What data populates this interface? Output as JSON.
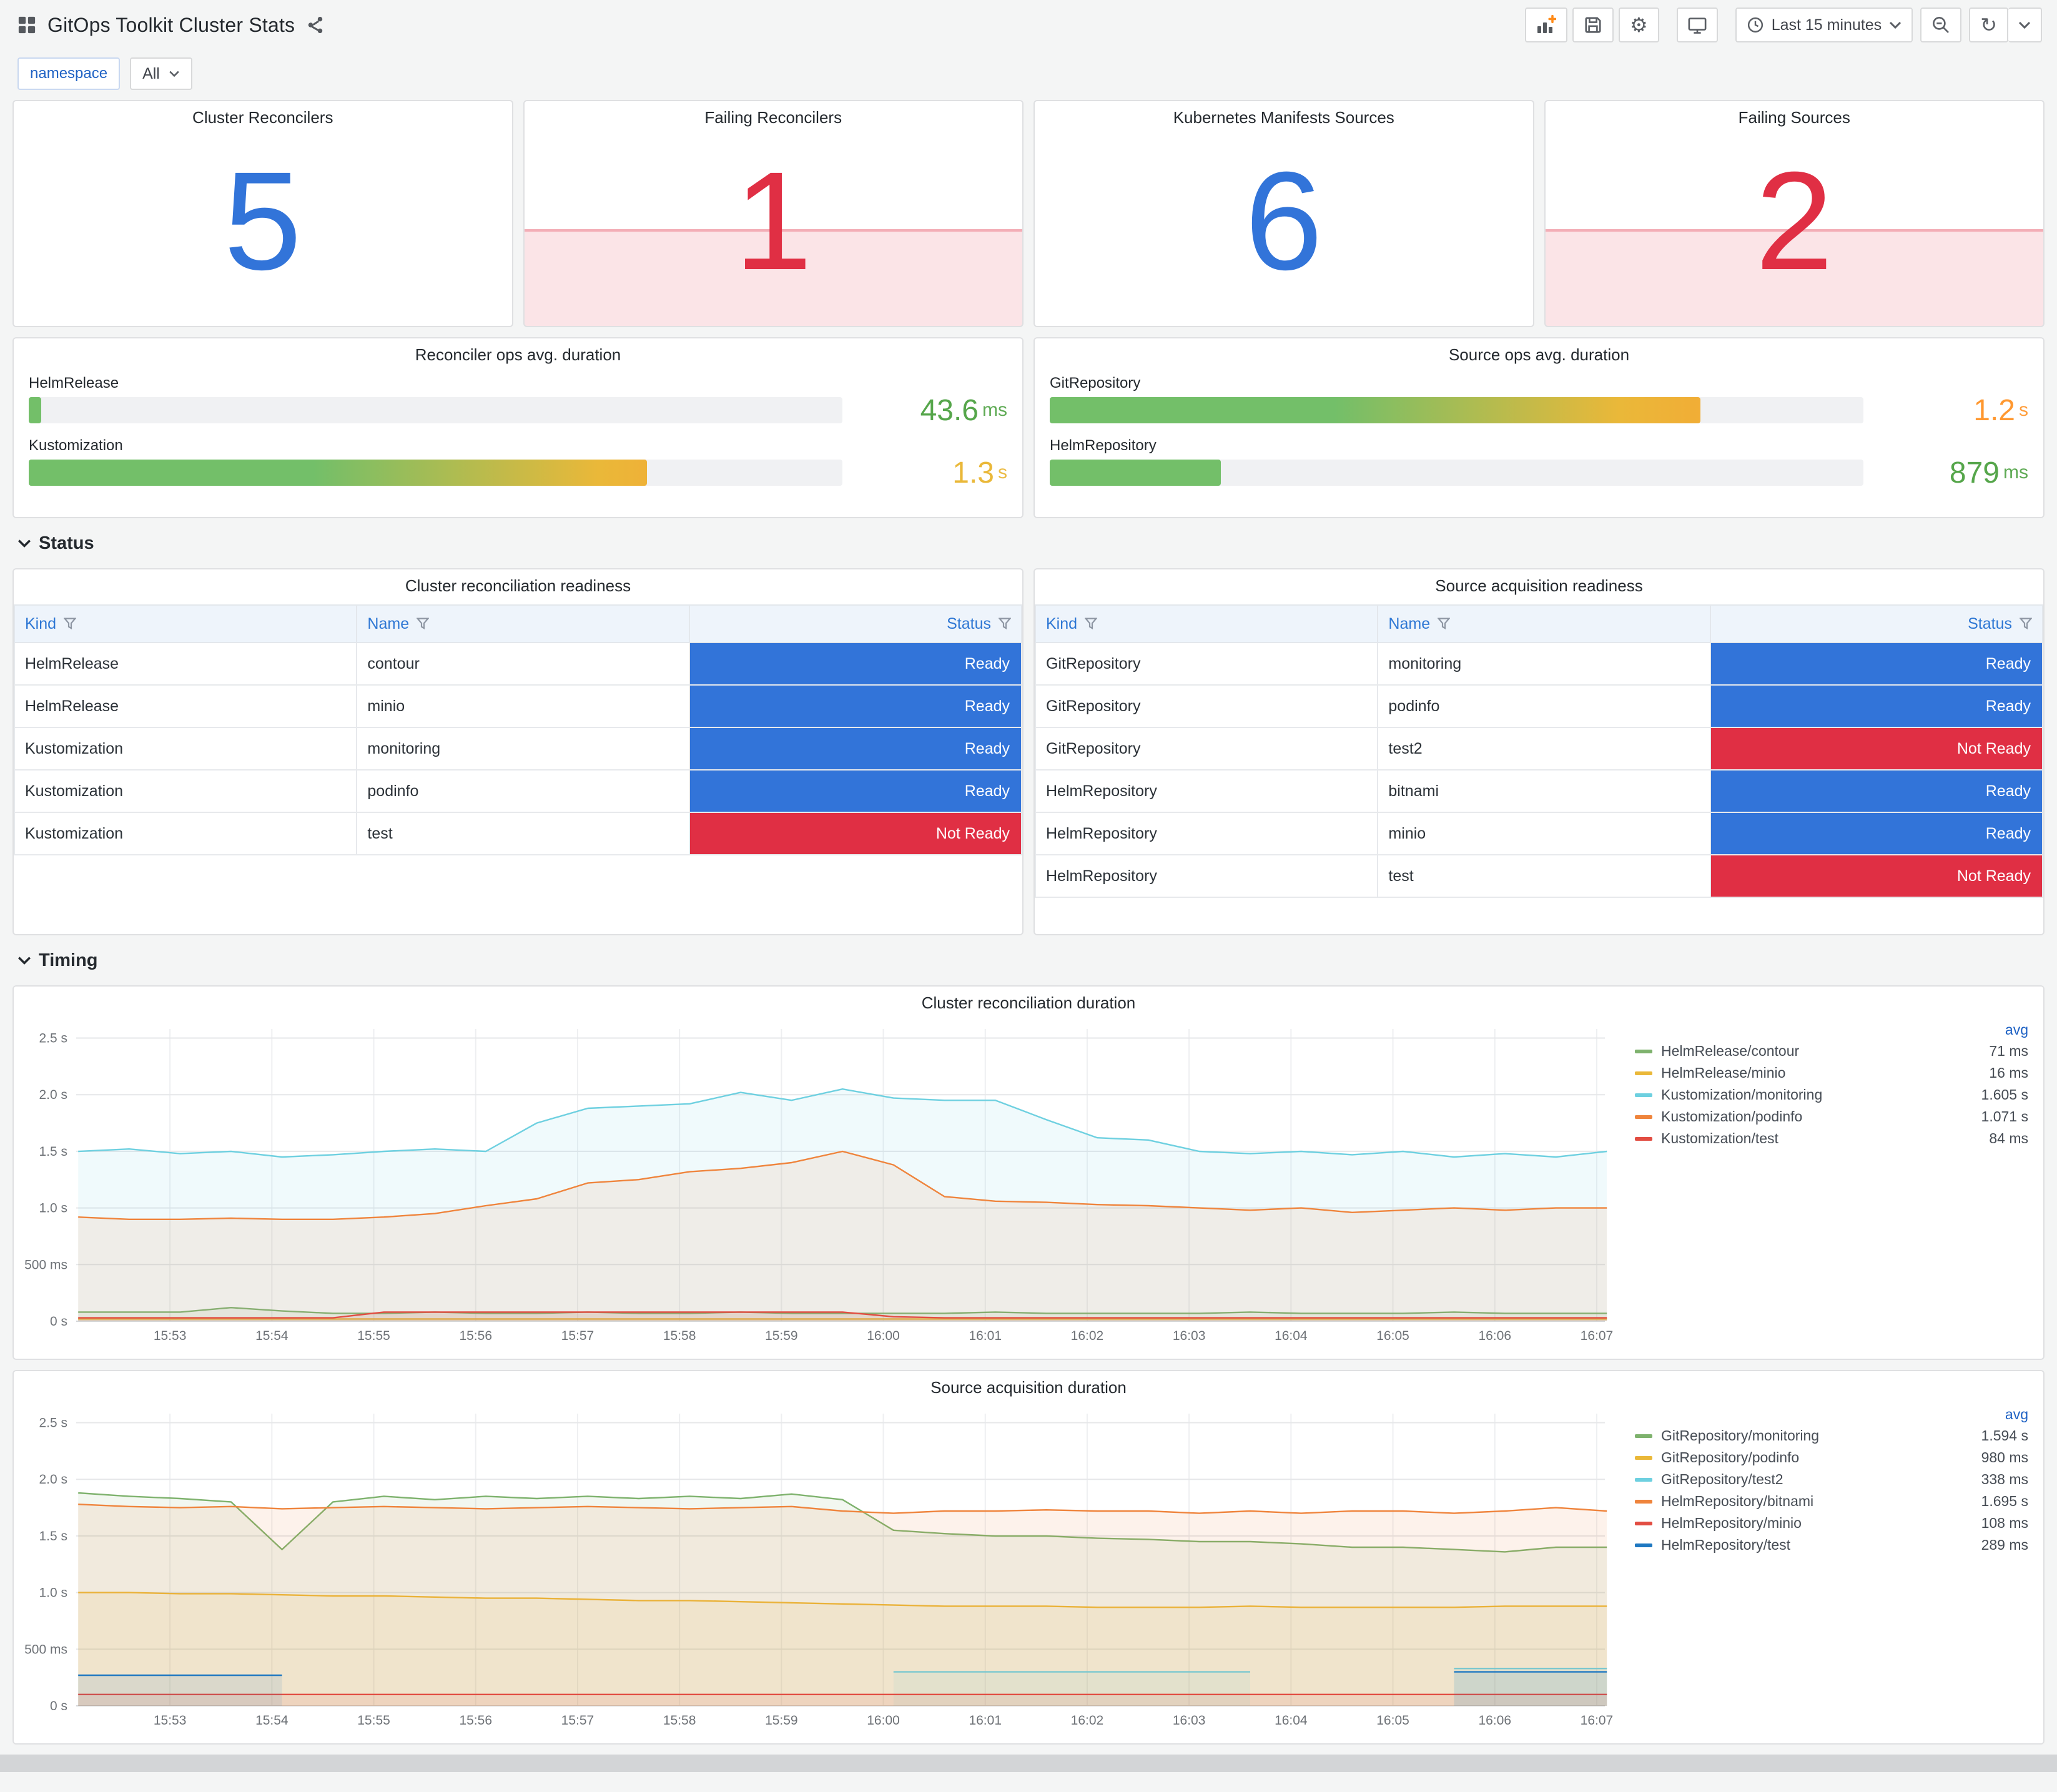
{
  "header": {
    "title": "GitOps Toolkit Cluster Stats",
    "time_range_label": "Last 15 minutes"
  },
  "icons": {
    "gear": "⚙",
    "refresh": "↻"
  },
  "variables": {
    "label": "namespace",
    "value": "All"
  },
  "sections": {
    "status": "Status",
    "timing": "Timing"
  },
  "status_colors": {
    "Ready": "#3274D9",
    "Not Ready": "#E02F44"
  },
  "gauge_gradient": [
    "#73BF69",
    "#EAB839",
    "#FF9830"
  ],
  "stats": [
    {
      "title": "Cluster Reconcilers",
      "value": "5",
      "value_color": "#3274D9",
      "alert": false
    },
    {
      "title": "Failing Reconcilers",
      "value": "1",
      "value_color": "#E02F44",
      "alert": true
    },
    {
      "title": "Kubernetes Manifests Sources",
      "value": "6",
      "value_color": "#3274D9",
      "alert": false
    },
    {
      "title": "Failing Sources",
      "value": "2",
      "value_color": "#E02F44",
      "alert": true
    }
  ],
  "gauges": [
    {
      "title": "Reconciler ops avg. duration",
      "rows": [
        {
          "label": "HelmRelease",
          "value": "43.6",
          "unit": "ms",
          "pct": 1.5,
          "value_color": "#56A64B"
        },
        {
          "label": "Kustomization",
          "value": "1.3",
          "unit": "s",
          "pct": 76,
          "value_color": "#EAB839"
        }
      ]
    },
    {
      "title": "Source ops avg. duration",
      "rows": [
        {
          "label": "GitRepository",
          "value": "1.2",
          "unit": "s",
          "pct": 80,
          "value_color": "#FF9830"
        },
        {
          "label": "HelmRepository",
          "value": "879",
          "unit": "ms",
          "pct": 21,
          "value_color": "#56A64B"
        }
      ]
    }
  ],
  "tables": [
    {
      "title": "Cluster reconciliation readiness",
      "headers": [
        "Kind",
        "Name",
        "Status"
      ],
      "rows": [
        {
          "kind": "HelmRelease",
          "name": "contour",
          "status": "Ready"
        },
        {
          "kind": "HelmRelease",
          "name": "minio",
          "status": "Ready"
        },
        {
          "kind": "Kustomization",
          "name": "monitoring",
          "status": "Ready"
        },
        {
          "kind": "Kustomization",
          "name": "podinfo",
          "status": "Ready"
        },
        {
          "kind": "Kustomization",
          "name": "test",
          "status": "Not Ready"
        }
      ]
    },
    {
      "title": "Source acquisition readiness",
      "headers": [
        "Kind",
        "Name",
        "Status"
      ],
      "rows": [
        {
          "kind": "GitRepository",
          "name": "monitoring",
          "status": "Ready"
        },
        {
          "kind": "GitRepository",
          "name": "podinfo",
          "status": "Ready"
        },
        {
          "kind": "GitRepository",
          "name": "test2",
          "status": "Not Ready"
        },
        {
          "kind": "HelmRepository",
          "name": "bitnami",
          "status": "Ready"
        },
        {
          "kind": "HelmRepository",
          "name": "minio",
          "status": "Ready"
        },
        {
          "kind": "HelmRepository",
          "name": "test",
          "status": "Not Ready"
        }
      ]
    }
  ],
  "chart_data": [
    {
      "type": "line",
      "title": "Cluster reconciliation duration",
      "legend_header": "avg",
      "legend_position": "right",
      "grid": true,
      "x_range": [
        52.08,
        67.08
      ],
      "y_range": [
        0,
        2.58
      ],
      "x_start": 52.1,
      "x_step": 0.5,
      "x_tick_values": [
        53,
        54,
        55,
        56,
        57,
        58,
        59,
        60,
        61,
        62,
        63,
        64,
        65,
        66,
        67
      ],
      "x_tick_labels": [
        "15:53",
        "15:54",
        "15:55",
        "15:56",
        "15:57",
        "15:58",
        "15:59",
        "16:00",
        "16:01",
        "16:02",
        "16:03",
        "16:04",
        "16:05",
        "16:06",
        "16:07"
      ],
      "y_tick_values": [
        0,
        0.5,
        1.0,
        1.5,
        2.0,
        2.5
      ],
      "y_tick_labels": [
        "0 s",
        "500 ms",
        "1.0 s",
        "1.5 s",
        "2.0 s",
        "2.5 s"
      ],
      "series": [
        {
          "name": "HelmRelease/contour",
          "color": "#7EB26D",
          "avg": "71 ms",
          "values": [
            0.08,
            0.08,
            0.08,
            0.12,
            0.09,
            0.07,
            0.07,
            0.08,
            0.07,
            0.07,
            0.08,
            0.07,
            0.07,
            0.08,
            0.07,
            0.07,
            0.07,
            0.07,
            0.08,
            0.07,
            0.07,
            0.07,
            0.07,
            0.08,
            0.07,
            0.07,
            0.07,
            0.08,
            0.07,
            0.07,
            0.07
          ]
        },
        {
          "name": "HelmRelease/minio",
          "color": "#EAB839",
          "avg": "16 ms",
          "values": [
            0.02,
            0.02,
            0.02,
            0.02,
            0.02,
            0.02,
            0.02,
            0.02,
            0.02,
            0.02,
            0.02,
            0.02,
            0.02,
            0.02,
            0.02,
            0.02,
            0.02,
            0.02,
            0.02,
            0.02,
            0.02,
            0.02,
            0.02,
            0.02,
            0.02,
            0.02,
            0.02,
            0.02,
            0.02,
            0.02,
            0.02
          ]
        },
        {
          "name": "Kustomization/monitoring",
          "color": "#6ED0E0",
          "avg": "1.605 s",
          "values": [
            1.5,
            1.52,
            1.48,
            1.5,
            1.45,
            1.47,
            1.5,
            1.52,
            1.5,
            1.75,
            1.88,
            1.9,
            1.92,
            2.02,
            1.95,
            2.05,
            1.97,
            1.95,
            1.95,
            1.78,
            1.62,
            1.6,
            1.5,
            1.48,
            1.5,
            1.47,
            1.5,
            1.45,
            1.48,
            1.45,
            1.5
          ]
        },
        {
          "name": "Kustomization/podinfo",
          "color": "#EF843C",
          "avg": "1.071 s",
          "values": [
            0.92,
            0.9,
            0.9,
            0.91,
            0.9,
            0.9,
            0.92,
            0.95,
            1.02,
            1.08,
            1.22,
            1.25,
            1.32,
            1.35,
            1.4,
            1.5,
            1.38,
            1.1,
            1.06,
            1.05,
            1.03,
            1.02,
            1.0,
            0.98,
            1.0,
            0.96,
            0.98,
            1.0,
            0.98,
            1.0,
            1.0
          ]
        },
        {
          "name": "Kustomization/test",
          "color": "#E24D42",
          "avg": "84 ms",
          "values": [
            0.03,
            0.03,
            0.03,
            0.03,
            0.03,
            0.03,
            0.08,
            0.08,
            0.08,
            0.08,
            0.08,
            0.08,
            0.08,
            0.08,
            0.08,
            0.08,
            0.04,
            0.03,
            0.03,
            0.03,
            0.03,
            0.03,
            0.03,
            0.03,
            0.03,
            0.03,
            0.03,
            0.03,
            0.03,
            0.03,
            0.03
          ]
        }
      ]
    },
    {
      "type": "line",
      "title": "Source acquisition duration",
      "legend_header": "avg",
      "legend_position": "right",
      "grid": true,
      "x_range": [
        52.08,
        67.08
      ],
      "y_range": [
        0,
        2.58
      ],
      "x_start": 52.1,
      "x_step": 0.5,
      "x_tick_values": [
        53,
        54,
        55,
        56,
        57,
        58,
        59,
        60,
        61,
        62,
        63,
        64,
        65,
        66,
        67
      ],
      "x_tick_labels": [
        "15:53",
        "15:54",
        "15:55",
        "15:56",
        "15:57",
        "15:58",
        "15:59",
        "16:00",
        "16:01",
        "16:02",
        "16:03",
        "16:04",
        "16:05",
        "16:06",
        "16:07"
      ],
      "y_tick_values": [
        0,
        0.5,
        1.0,
        1.5,
        2.0,
        2.5
      ],
      "y_tick_labels": [
        "0 s",
        "500 ms",
        "1.0 s",
        "1.5 s",
        "2.0 s",
        "2.5 s"
      ],
      "series": [
        {
          "name": "GitRepository/monitoring",
          "color": "#7EB26D",
          "avg": "1.594 s",
          "values": [
            1.88,
            1.85,
            1.83,
            1.8,
            1.38,
            1.8,
            1.85,
            1.82,
            1.85,
            1.83,
            1.85,
            1.83,
            1.85,
            1.83,
            1.87,
            1.82,
            1.55,
            1.52,
            1.5,
            1.5,
            1.48,
            1.47,
            1.45,
            1.45,
            1.43,
            1.4,
            1.4,
            1.38,
            1.36,
            1.4,
            1.4
          ]
        },
        {
          "name": "GitRepository/podinfo",
          "color": "#EAB839",
          "avg": "980 ms",
          "values": [
            1.0,
            1.0,
            0.99,
            0.99,
            0.98,
            0.97,
            0.97,
            0.96,
            0.95,
            0.95,
            0.94,
            0.93,
            0.93,
            0.92,
            0.91,
            0.9,
            0.89,
            0.88,
            0.88,
            0.88,
            0.87,
            0.87,
            0.87,
            0.88,
            0.87,
            0.87,
            0.87,
            0.87,
            0.88,
            0.88,
            0.88
          ]
        },
        {
          "name": "GitRepository/test2",
          "color": "#6ED0E0",
          "avg": "338 ms",
          "values": [
            null,
            null,
            null,
            null,
            null,
            null,
            null,
            null,
            null,
            null,
            null,
            null,
            null,
            null,
            null,
            null,
            0.3,
            0.3,
            0.3,
            0.3,
            0.3,
            0.3,
            0.3,
            0.3,
            null,
            null,
            null,
            0.33,
            0.33,
            0.33,
            0.33
          ]
        },
        {
          "name": "HelmRepository/bitnami",
          "color": "#EF843C",
          "avg": "1.695 s",
          "values": [
            1.78,
            1.76,
            1.75,
            1.76,
            1.74,
            1.75,
            1.76,
            1.75,
            1.74,
            1.75,
            1.76,
            1.75,
            1.74,
            1.75,
            1.76,
            1.72,
            1.7,
            1.72,
            1.72,
            1.73,
            1.72,
            1.72,
            1.7,
            1.72,
            1.7,
            1.72,
            1.72,
            1.7,
            1.72,
            1.75,
            1.72
          ]
        },
        {
          "name": "HelmRepository/minio",
          "color": "#E24D42",
          "avg": "108 ms",
          "values": [
            0.1,
            0.1,
            0.1,
            0.1,
            0.1,
            0.1,
            0.1,
            0.1,
            0.1,
            0.1,
            0.1,
            0.1,
            0.1,
            0.1,
            0.1,
            0.1,
            0.1,
            0.1,
            0.1,
            0.1,
            0.1,
            0.1,
            0.1,
            0.1,
            0.1,
            0.1,
            0.1,
            0.1,
            0.1,
            0.1,
            0.1
          ]
        },
        {
          "name": "HelmRepository/test",
          "color": "#1F78C1",
          "avg": "289 ms",
          "values": [
            0.27,
            0.27,
            0.27,
            0.27,
            0.27,
            null,
            null,
            null,
            null,
            null,
            null,
            null,
            null,
            null,
            null,
            null,
            null,
            null,
            null,
            null,
            null,
            null,
            null,
            null,
            null,
            null,
            null,
            0.3,
            0.3,
            0.3,
            0.3
          ]
        }
      ]
    }
  ]
}
